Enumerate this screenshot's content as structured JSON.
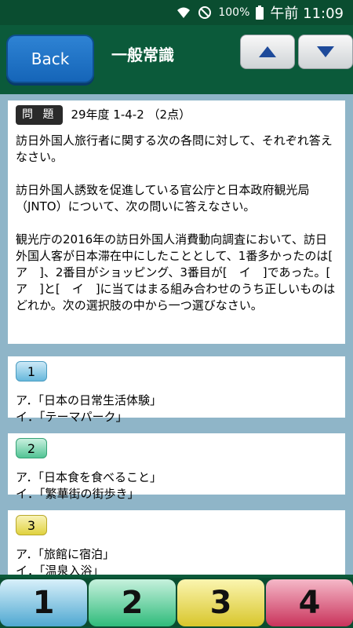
{
  "status": {
    "battery": "100%",
    "time": "午前 11:09"
  },
  "header": {
    "back_label": "Back",
    "title": "一般常識"
  },
  "question": {
    "badge": "問 題",
    "meta": "29年度 1-4-2 （2点）",
    "para1": "訪日外国人旅行者に関する次の各問に対して、それぞれ答えなさい。",
    "para2": "訪日外国人誘致を促進している官公庁と日本政府観光局（JNTO）について、次の問いに答えなさい。",
    "para3": "観光庁の2016年の訪日外国人消費動向調査において、訪日外国人客が日本滞在中にしたこととして、1番多かったのは[　ア　]、2番目がショッピング、3番目が[　イ　]であった。[　ア　]と[　イ　]に当てはまる組み合わせのうち正しいものはどれか。次の選択肢の中から一つ選びなさい。"
  },
  "options": [
    {
      "num": "1",
      "a": "ア．「日本の日常生活体験」",
      "i": "イ．「テーマパーク」"
    },
    {
      "num": "2",
      "a": "ア．「日本食を食べること」",
      "i": "イ．「繁華街の街歩き」"
    },
    {
      "num": "3",
      "a": "ア．「旅館に宿泊」",
      "i": "イ．「温泉入浴」"
    }
  ],
  "answers": [
    "1",
    "2",
    "3",
    "4"
  ]
}
